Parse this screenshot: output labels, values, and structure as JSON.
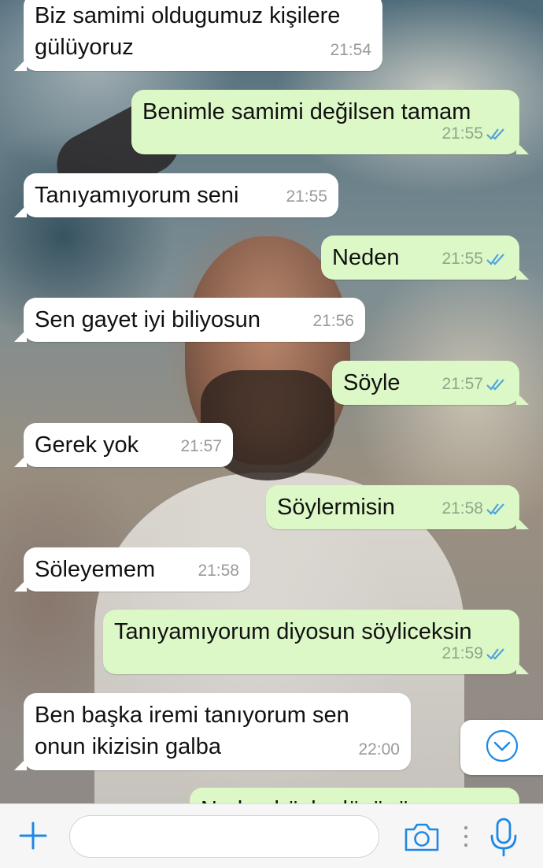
{
  "messages": [
    {
      "direction": "in",
      "text": "Biz samimi oldugumuz kişilere gülüyoruz",
      "time": "21:54",
      "read": false
    },
    {
      "direction": "out",
      "text": "Benimle samimi değilsen tamam",
      "time": "21:55",
      "read": true
    },
    {
      "direction": "in",
      "text": "Tanıyamıyorum seni",
      "time": "21:55",
      "read": false
    },
    {
      "direction": "out",
      "text": "Neden",
      "time": "21:55",
      "read": true
    },
    {
      "direction": "in",
      "text": "Sen gayet iyi biliyosun",
      "time": "21:56",
      "read": false
    },
    {
      "direction": "out",
      "text": "Söyle",
      "time": "21:57",
      "read": true
    },
    {
      "direction": "in",
      "text": "Gerek yok",
      "time": "21:57",
      "read": false
    },
    {
      "direction": "out",
      "text": "Söylermisin",
      "time": "21:58",
      "read": true
    },
    {
      "direction": "in",
      "text": "Söleyemem",
      "time": "21:58",
      "read": false
    },
    {
      "direction": "out",
      "text": "Tanıyamıyorum diyosun söyliceksin",
      "time": "21:59",
      "read": true
    },
    {
      "direction": "in",
      "text": "Ben başka iremi tanıyorum sen onun ikizisin galba",
      "time": "22:00",
      "read": false
    },
    {
      "direction": "out",
      "text": "Neden böyle düşünüyosun",
      "time": "",
      "read": true
    }
  ],
  "colors": {
    "incoming_bubble": "#ffffff",
    "outgoing_bubble": "#dcf8c6",
    "read_ticks": "#4fa3e0",
    "accent": "#1e88e5"
  },
  "icons": {
    "plus": "plus-icon",
    "camera": "camera-icon",
    "more": "more-dots-icon",
    "mic": "microphone-icon",
    "scroll_down": "chevron-down-circle-icon",
    "read_receipt": "double-check-icon"
  },
  "input": {
    "value": "",
    "placeholder": ""
  }
}
